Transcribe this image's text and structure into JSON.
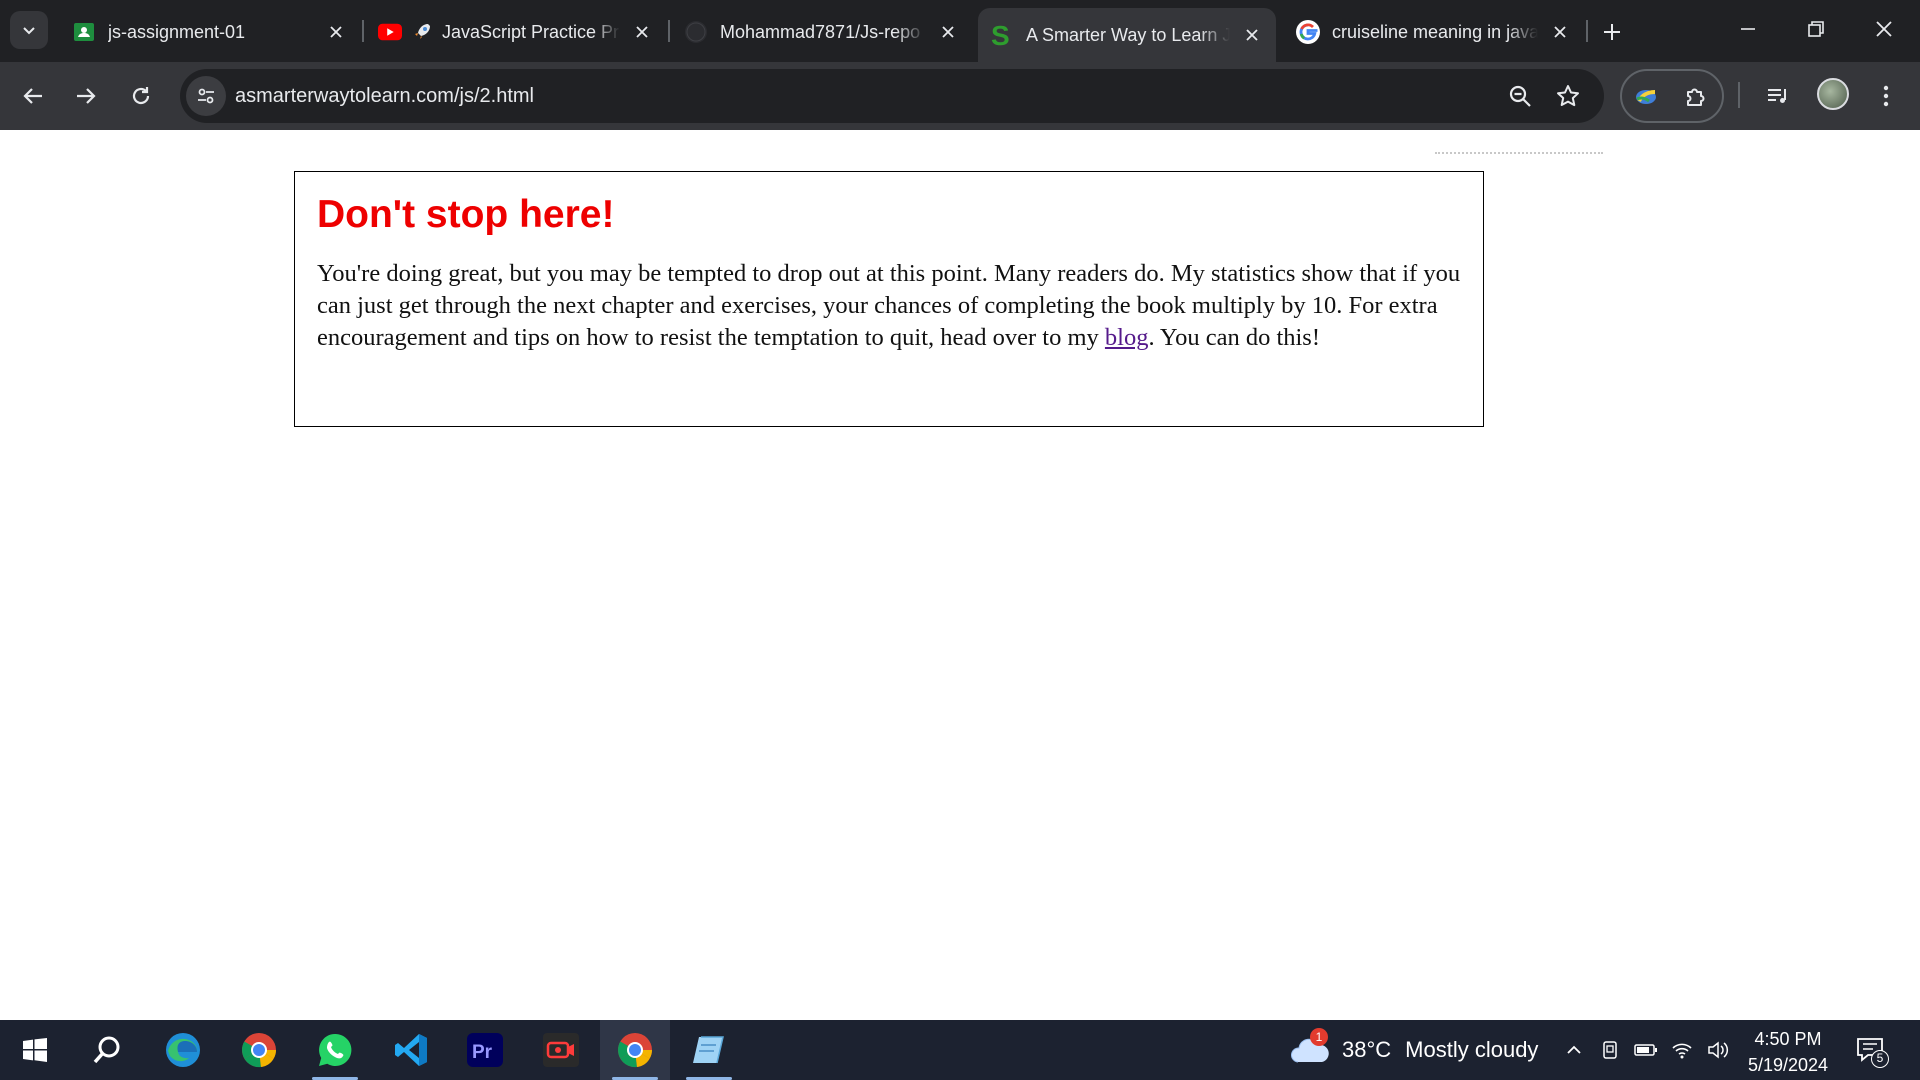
{
  "browser": {
    "tabs": [
      {
        "title": "js-assignment-01",
        "favicon": "google-classroom-icon",
        "active": false
      },
      {
        "title": "JavaScript Practice Pr",
        "favicon": "youtube-icon",
        "active": false
      },
      {
        "title": "Mohammad7871/Js-repo",
        "favicon": "github-icon",
        "active": false
      },
      {
        "title": "A Smarter Way to Learn J",
        "favicon": "smarter-way-s-icon",
        "active": true
      },
      {
        "title": "cruiseline meaning in java",
        "favicon": "google-g-icon",
        "active": false
      }
    ],
    "url": "asmarterwaytolearn.com/js/2.html",
    "colors": {
      "frame": "#202124",
      "toolbar": "#35363a",
      "omnibox": "#202124"
    }
  },
  "page": {
    "heading": "Don't stop here!",
    "body_before_link": "You're doing great, but you may be tempted to drop out at this point. Many readers do. My statistics show that if you can just get through the next chapter and exercises, your chances of completing the book multiply by 10. For extra encouragement and tips on how to resist the temptation to quit, head over to my ",
    "link_text": "blog",
    "body_after_link": ". You can do this!",
    "colors": {
      "heading": "#ee0000",
      "link": "#551a8b"
    }
  },
  "taskbar": {
    "apps": [
      "start",
      "search",
      "edge",
      "chrome",
      "whatsapp",
      "vscode",
      "premiere-pro",
      "screen-recorder",
      "chrome-active",
      "notepad"
    ],
    "weather": {
      "temperature": "38°C",
      "condition": "Mostly cloudy",
      "badge": "1"
    },
    "time": "4:50 PM",
    "date": "5/19/2024",
    "notification_count": "5"
  }
}
